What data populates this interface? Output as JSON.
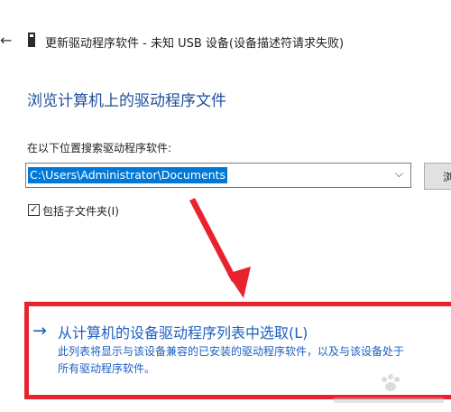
{
  "header": {
    "back_glyph": "←",
    "window_title": "更新驱动程序软件 - 未知 USB 设备(设备描述符请求失败)"
  },
  "main": {
    "page_title": "浏览计算机上的驱动程序文件",
    "search_label": "在以下位置搜索驱动程序软件:",
    "path_value": "C:\\Users\\Administrator\\Documents",
    "browse_label": "浏",
    "include_subfolders_label": "包括子文件夹(I)",
    "include_subfolders_checked": true
  },
  "option": {
    "arrow_glyph": "→",
    "title": "从计算机的设备驱动程序列表中选取(L)",
    "description_line1": "此列表将显示与该设备兼容的已安装的驱动程序软件，以及与该设备处于",
    "description_line2": "所有驱动程序软件。"
  },
  "colors": {
    "accent": "#1e5fc1",
    "highlight": "#e8232f",
    "selection": "#0078d7"
  },
  "icons": {
    "back": "back-arrow-icon",
    "device": "usb-device-icon",
    "dropdown": "chevron-down-icon",
    "check": "checkmark-icon",
    "watermark": "baidu-paw-watermark"
  }
}
